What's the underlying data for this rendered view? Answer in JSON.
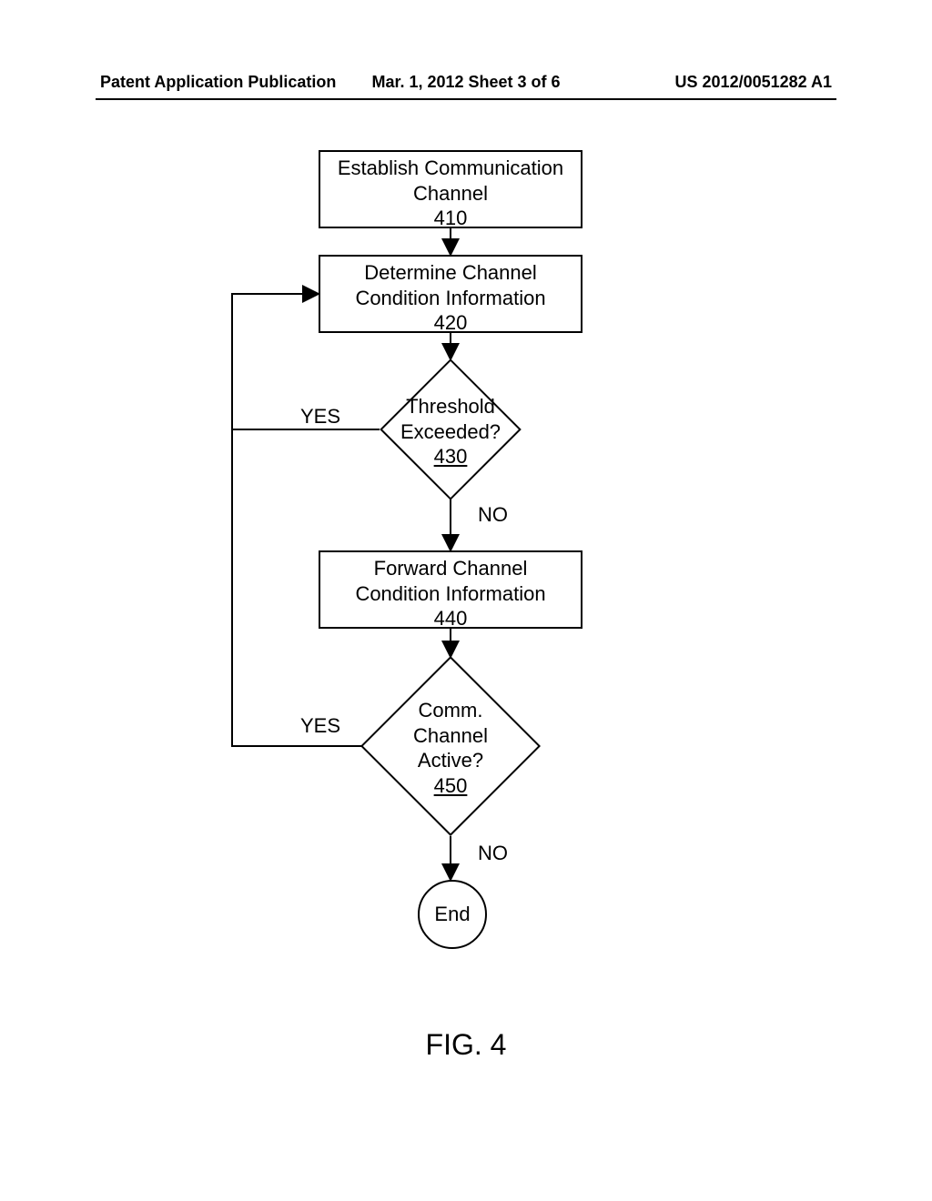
{
  "header": {
    "left": "Patent Application Publication",
    "center": "Mar. 1, 2012   Sheet 3 of 6",
    "right": "US 2012/0051282 A1"
  },
  "steps": {
    "s410": {
      "t1": "Establish Communication",
      "t2": "Channel",
      "num": "410"
    },
    "s420": {
      "t1": "Determine Channel",
      "t2": "Condition Information",
      "num": "420"
    },
    "s430": {
      "t1": "Threshold",
      "t2": "Exceeded?",
      "num": "430"
    },
    "s440": {
      "t1": "Forward Channel",
      "t2": "Condition Information",
      "num": "440"
    },
    "s450": {
      "t1": "Comm.",
      "t2": "Channel",
      "t3": "Active?",
      "num": "450"
    },
    "end": "End"
  },
  "labels": {
    "yes": "YES",
    "no": "NO"
  },
  "figure": "FIG. 4"
}
